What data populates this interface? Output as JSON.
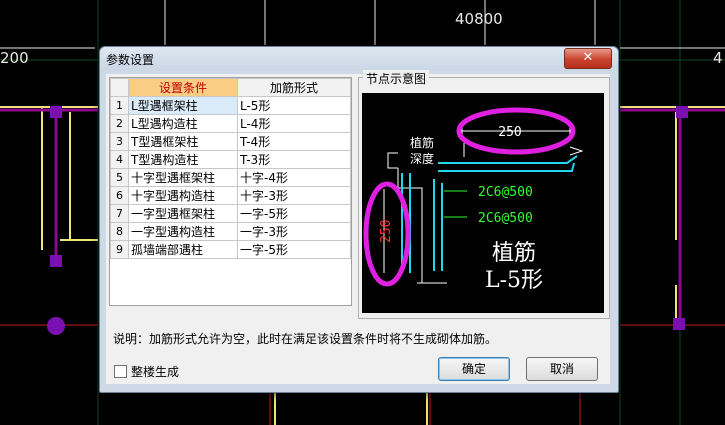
{
  "background": {
    "dimension_top": "40800",
    "dimension_left": "200",
    "dimension_right": "4"
  },
  "dialog": {
    "title": "参数设置",
    "close_glyph": "✕",
    "table": {
      "headers": [
        "设置条件",
        "加筋形式"
      ],
      "rows": [
        {
          "num": "1",
          "condition": "L型遇框架柱",
          "form": "L-5形"
        },
        {
          "num": "2",
          "condition": "L型遇构造柱",
          "form": "L-4形"
        },
        {
          "num": "3",
          "condition": "T型遇框架柱",
          "form": "T-4形"
        },
        {
          "num": "4",
          "condition": "T型遇构造柱",
          "form": "T-3形"
        },
        {
          "num": "5",
          "condition": "十字型遇框架柱",
          "form": "十字-4形"
        },
        {
          "num": "6",
          "condition": "十字型遇构造柱",
          "form": "十字-3形"
        },
        {
          "num": "7",
          "condition": "一字型遇框架柱",
          "form": "一字-5形"
        },
        {
          "num": "8",
          "condition": "一字型遇构造柱",
          "form": "一字-3形"
        },
        {
          "num": "9",
          "condition": "孤墙端部遇柱",
          "form": "一字-5形"
        }
      ]
    },
    "preview": {
      "caption": "节点示意图",
      "dim_top": "250",
      "dim_side": "250",
      "label_anchor_line1": "植筋",
      "label_anchor_line2": "深度",
      "rebar_1": "2C6@500",
      "rebar_2": "2C6@500",
      "title_line1": "植筋",
      "title_line2": "L-5形"
    },
    "note": "说明：加筋形式允许为空，此时在满足该设置条件时将不生成砌体加筋。",
    "checkbox_label": "整楼生成",
    "checkbox_checked": false,
    "ok_label": "确定",
    "cancel_label": "取消"
  }
}
